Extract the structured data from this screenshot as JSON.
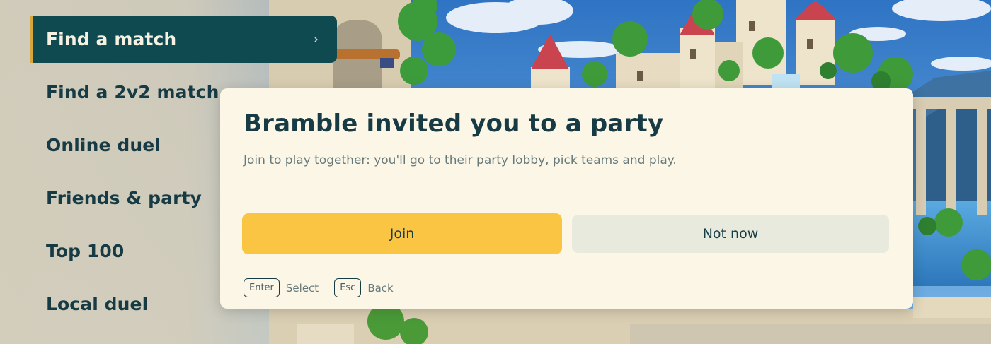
{
  "menu": {
    "items": [
      {
        "label": "Find a match",
        "active": true,
        "chevron": "›"
      },
      {
        "label": "Find a 2v2 match"
      },
      {
        "label": "Online duel"
      },
      {
        "label": "Friends & party"
      },
      {
        "label": "Top 100"
      },
      {
        "label": "Local duel"
      }
    ]
  },
  "dialog": {
    "title": "Bramble invited you to a party",
    "body": "Join to play together: you'll go to their party lobby, pick teams and play.",
    "join_label": "Join",
    "not_now_label": "Not now"
  },
  "hints": [
    {
      "key": "Enter",
      "label": "Select"
    },
    {
      "key": "Esc",
      "label": "Back"
    }
  ],
  "colors": {
    "accent": "#0f4a51",
    "primary_button": "#fbc544",
    "secondary_button": "#e7eadc",
    "dialog_bg": "#fcf6e6",
    "text_dark": "#173b45"
  }
}
